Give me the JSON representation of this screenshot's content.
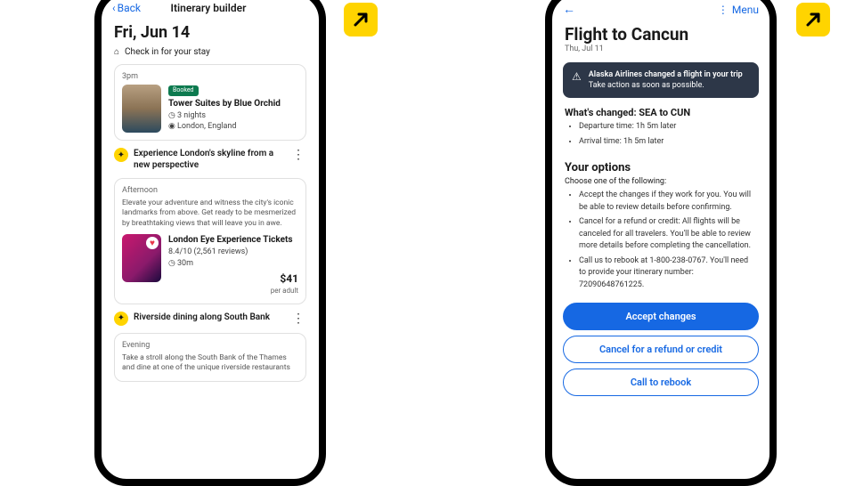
{
  "left": {
    "back": "Back",
    "title": "Itinerary builder",
    "date": "Fri, Jun 14",
    "checkin": "Check in for your stay",
    "card1": {
      "time": "3pm",
      "badge": "Booked",
      "name": "Tower Suites by Blue Orchid",
      "nights": "3 nights",
      "loc": "London, England"
    },
    "exp1": "Experience London's skyline from a new perspective",
    "afternoon": "Afternoon",
    "desc1": "Elevate your adventure and witness the city's iconic landmarks from above. Get ready to be mesmerized by breathtaking views that will leave you in awe.",
    "card2": {
      "name": "London Eye Experience Tickets",
      "rating": "8.4/10 (2,561 reviews)",
      "duration": "30m",
      "price": "$41",
      "unit": "per adult"
    },
    "exp2": "Riverside dining along South Bank",
    "evening": "Evening",
    "desc2": "Take a stroll along the South Bank of the Thames and dine at one of the unique riverside restaurants"
  },
  "right": {
    "menu": "Menu",
    "title": "Flight to Cancun",
    "sub": "Thu, Jul 11",
    "alert": {
      "line1": "Alaska Airlines changed a flight in your trip",
      "line2": "Take action as soon as possible."
    },
    "changed_hd": "What's changed: SEA to CUN",
    "changed1": "Departure time: 1h 5m later",
    "changed2": "Arrival time: 1h 5m later",
    "options_hd": "Your options",
    "options_sub": "Choose one of the following:",
    "opt1": "Accept the changes if they work for you. You will be able to review details before confirming.",
    "opt2": "Cancel for a refund or credit: All flights will be canceled for all travelers. You'll be able to review more details before completing the cancellation.",
    "opt3": "Call us to rebook at 1-800-238-0767. You'll need to provide your itinerary number: 72090648761225.",
    "btn1": "Accept changes",
    "btn2": "Cancel for a refund or credit",
    "btn3": "Call to rebook"
  }
}
